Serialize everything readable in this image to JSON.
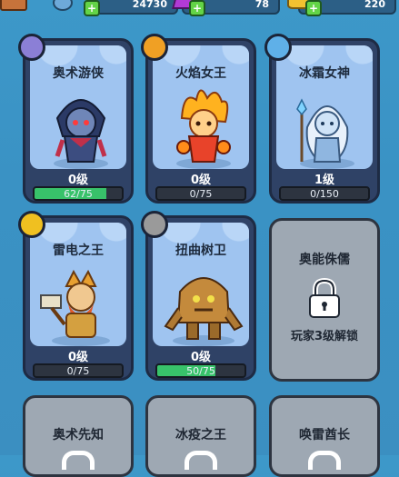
{
  "currency": [
    {
      "value": "24730",
      "icon": "gold-coin-icon"
    },
    {
      "value": "78",
      "icon": "purple-gem-icon"
    },
    {
      "value": "220",
      "icon": "gold-pile-icon"
    }
  ],
  "heroes": [
    {
      "name": "奥术游侠",
      "level": "0级",
      "progress": "62/75",
      "fill": 0.827,
      "badge_color": "#8b7fd6",
      "badge_icon": "bow-arrow-icon"
    },
    {
      "name": "火焰女王",
      "level": "0级",
      "progress": "0/75",
      "fill": 0,
      "badge_color": "#f0a024",
      "badge_icon": "fire-ring-icon"
    },
    {
      "name": "冰霜女神",
      "level": "1级",
      "progress": "0/150",
      "fill": 0,
      "badge_color": "#5fb0e8",
      "badge_icon": "ice-crystal-icon"
    },
    {
      "name": "雷电之王",
      "level": "0级",
      "progress": "0/75",
      "fill": 0,
      "badge_color": "#f0c020",
      "badge_icon": "lightning-icon"
    },
    {
      "name": "扭曲树卫",
      "level": "0级",
      "progress": "50/75",
      "fill": 0.667,
      "badge_color": "#9a9a9a",
      "badge_icon": "wood-shield-icon"
    }
  ],
  "locked_hero": {
    "name": "奥能侏儒",
    "unlock_text": "玩家3级解锁"
  },
  "bottom_row": [
    "奥术先知",
    "冰疫之王",
    "唤雷酋长"
  ]
}
